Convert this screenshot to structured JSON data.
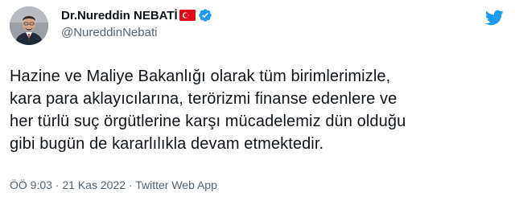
{
  "author": {
    "display_name": "Dr.Nureddin NEBATİ",
    "handle": "@NureddinNebati"
  },
  "icons": {
    "flag": "turkey-flag-icon",
    "verified": "verified-badge-icon",
    "logo": "twitter-bird-icon"
  },
  "colors": {
    "verified_blue": "#1d9bf0",
    "flag_red": "#e30a17",
    "text_primary": "#0f1419",
    "text_secondary": "#536471"
  },
  "tweet": {
    "lines": [
      "Hazine ve Maliye Bakanlığı olarak tüm birimlerimizle,",
      "kara para aklayıcılarına, terörizmi finanse edenlere ve",
      "her türlü suç örgütlerine karşı mücadelemiz dün olduğu",
      "gibi bugün de kararlılıkla devam etmektedir."
    ]
  },
  "meta": {
    "time": "ÖÖ 9:03",
    "separator": " · ",
    "date": "21 Kas 2022",
    "source": "Twitter Web App"
  }
}
